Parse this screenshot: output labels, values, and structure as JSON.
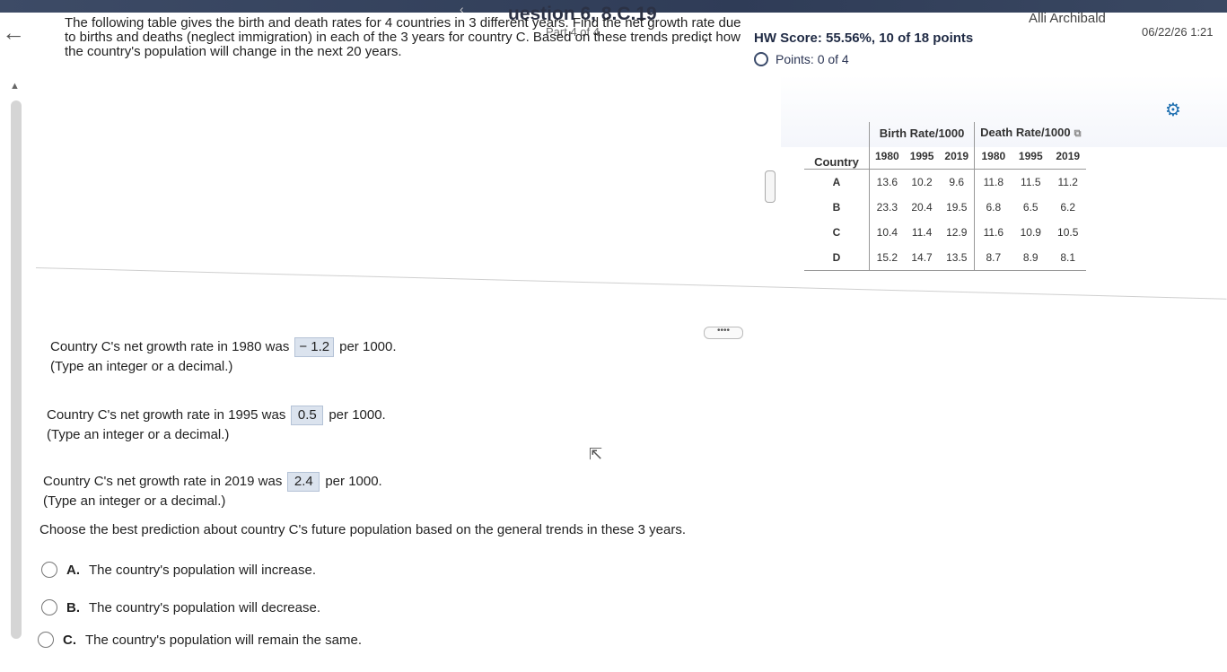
{
  "header": {
    "question_title": "uestion 6, 8.C.19",
    "part_label": "Part 4 of 4",
    "user_name": "Alli Archibald",
    "date_time": "06/22/26 1:21",
    "hw_score": "HW Score: 55.56%, 10 of 18 points",
    "points": "Points: 0 of 4"
  },
  "problem": {
    "intro": "The following table gives the birth and death rates for 4 countries in 3 different years. Find the net growth rate due to births and deaths (neglect immigration) in each of the 3 years for country C. Based on these trends predict how the country's population will change in the next 20 years."
  },
  "table": {
    "group_headers": {
      "country": "Country",
      "birth": "Birth Rate/1000",
      "death": "Death Rate/1000"
    },
    "years": [
      "1980",
      "1995",
      "2019",
      "1980",
      "1995",
      "2019"
    ],
    "rows": [
      {
        "country": "A",
        "values": [
          "13.6",
          "10.2",
          "9.6",
          "11.8",
          "11.5",
          "11.2"
        ]
      },
      {
        "country": "B",
        "values": [
          "23.3",
          "20.4",
          "19.5",
          "6.8",
          "6.5",
          "6.2"
        ]
      },
      {
        "country": "C",
        "values": [
          "10.4",
          "11.4",
          "12.9",
          "11.6",
          "10.9",
          "10.5"
        ]
      },
      {
        "country": "D",
        "values": [
          "15.2",
          "14.7",
          "13.5",
          "8.7",
          "8.9",
          "8.1"
        ]
      }
    ]
  },
  "answers": [
    {
      "prefix": "Country C's net growth rate in 1980 was",
      "value": "− 1.2",
      "suffix": "per 1000.",
      "hint": "(Type an integer or a decimal.)"
    },
    {
      "prefix": "Country C's net growth rate in 1995 was",
      "value": "0.5",
      "suffix": "per 1000.",
      "hint": "(Type an integer or a decimal.)"
    },
    {
      "prefix": "Country C's net growth rate in 2019 was",
      "value": "2.4",
      "suffix": "per 1000.",
      "hint": "(Type an integer or a decimal.)"
    }
  ],
  "choice_question": "Choose the best prediction about country C's future population based on the general trends in these 3 years.",
  "options": [
    {
      "letter": "A.",
      "text": "The country's population will increase."
    },
    {
      "letter": "B.",
      "text": "The country's population will decrease."
    },
    {
      "letter": "C.",
      "text": "The country's population will remain the same."
    }
  ],
  "icons": {
    "back": "back-arrow-icon",
    "prev": "chevron-left-icon",
    "next": "chevron-right-icon",
    "settings": "gear-icon",
    "copy": "copy-icon",
    "more": "more-icon",
    "cursor": "mouse-cursor-icon"
  },
  "colors": {
    "header_bar": "#2f3c57",
    "answer_box": "#dbe3ee",
    "settings_accent": "#1d6fb0"
  }
}
